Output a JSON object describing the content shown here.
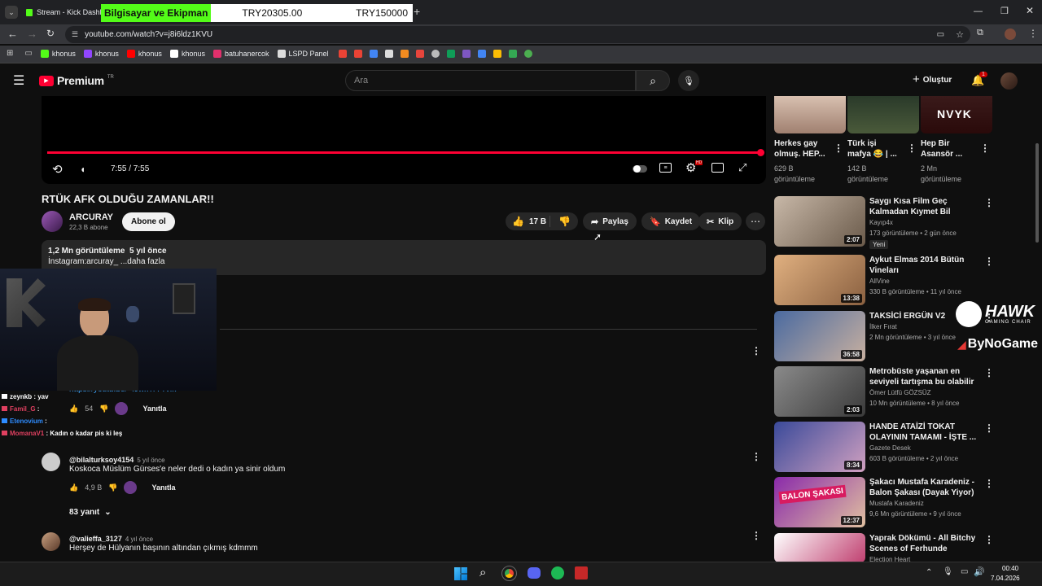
{
  "browser": {
    "tab_title": "Stream - Kick Dashbo",
    "new_tab": "+",
    "url": "youtube.com/watch?v=j8i6ldz1KVU",
    "bookmarks": [
      {
        "label": "khonus",
        "color": "#53fc18"
      },
      {
        "label": "khonus",
        "color": "#9146ff"
      },
      {
        "label": "khonus",
        "color": "#ff0000"
      },
      {
        "label": "khonus",
        "color": "#ffffff"
      },
      {
        "label": "batuhanercok",
        "color": "#e1306c"
      },
      {
        "label": "LSPD Panel",
        "color": "#dddddd"
      }
    ]
  },
  "overlay_banner": {
    "label": "Bilgisayar ve Ekipman",
    "value1": "TRY20305.00",
    "value2": "TRY150000"
  },
  "youtube": {
    "logo": "Premium",
    "region": "TR",
    "search_placeholder": "Ara",
    "create_label": "Oluştur",
    "notif_count": "1"
  },
  "player": {
    "time": "7:55 / 7:55",
    "progress": 1.0,
    "accent": "#ff0033"
  },
  "video": {
    "title": "RTÜK AFK OLDUĞU ZAMANLAR!!",
    "channel": "ARCURAY",
    "subs": "22,3 B abone",
    "subscribe": "Abone ol",
    "likes": "17 B",
    "share": "Paylaş",
    "save": "Kaydet",
    "clip": "Klip",
    "views_line": "1,2 Mn görüntüleme  5 yıl önce",
    "desc": "İnstagram:arcuray_ ...daha fazla"
  },
  "comments": [
    {
      "link": "https://youtu.be/-4JwxTrTYvIk",
      "likes": "54",
      "reply": "Yanıtla"
    },
    {
      "author": "@bilalturksoy4154",
      "time": "5 yıl önce",
      "text": "Koskoca Müslüm Gürses'e neler dedi o kadın ya sinir oldum",
      "likes": "4,9 B",
      "reply": "Yanıtla",
      "replies": "83 yanıt"
    },
    {
      "author": "@valieffa_3127",
      "time": "4 yıl önce",
      "text": "Herşey de Hülyanın başının altından çıkmış kdmmm"
    }
  ],
  "chat": [
    {
      "user": "zeynkb",
      "msg": " : yav",
      "color": "#ffffff"
    },
    {
      "user": "Famil_G",
      "msg": " : ",
      "color": "#e04060"
    },
    {
      "user": "Etenovium",
      "msg": " : ",
      "color": "#2e8cff"
    },
    {
      "user": "MomanaV1",
      "msg": " : Kadın o kadar pis ki leş",
      "color": "#e04060"
    }
  ],
  "top_recs": [
    {
      "title": "Herkes gay olmuş. HEP...",
      "views": "629 B",
      "unit": "görüntüleme"
    },
    {
      "title": "Türk işi mafya 😂 | ...",
      "views": "142 B",
      "unit": "görüntüleme"
    },
    {
      "title": "Hep Bir Asansör ...",
      "views": "2 Mn",
      "unit": "görüntüleme"
    }
  ],
  "nvyk_text": "NVYK",
  "recs": [
    {
      "title": "Saygı Kısa Film Geç Kalmadan Kıymet Bil",
      "channel": "Kayıp4x",
      "meta": "173 görüntüleme • 2 gün önce",
      "badge": "Yeni",
      "duration": "2:07"
    },
    {
      "title": "Aykut Elmas 2014 Bütün Vineları",
      "channel": "AllVine",
      "meta": "330 B görüntüleme • 11 yıl önce",
      "duration": "13:38"
    },
    {
      "title": "TAKSİCİ ERGÜN V2",
      "channel": "İlker Fırat",
      "meta": "2 Mn görüntüleme • 3 yıl önce",
      "duration": "36:58"
    },
    {
      "title": "Metrobüste yaşanan en seviyeli tartışma bu olabilir",
      "channel": "Ömer Lütfü GÖZSÜZ",
      "meta": "10 Mn görüntüleme • 8 yıl önce",
      "duration": "2:03"
    },
    {
      "title": "HANDE ATAİZİ TOKAT OLAYININ TAMAMI - İŞTE ...",
      "channel": "Gazete Desek",
      "meta": "603 B görüntüleme • 2 yıl önce",
      "duration": "8:34"
    },
    {
      "title": "Şakacı Mustafa Karadeniz - Balon Şakası (Dayak Yiyor)",
      "channel": "Mustafa Karadeniz",
      "meta": "9,6 Mn görüntüleme • 9 yıl önce",
      "duration": "12:37"
    },
    {
      "title": "Yaprak Dökümü - All Bitchy Scenes of Ferhunde",
      "channel": "Election Heart"
    }
  ],
  "sponsor": {
    "hawk": "HAWK",
    "hawk_sub": "GAMING CHAIR",
    "bng": "ByNoGame"
  },
  "balon_text": "BALON ŞAKASI",
  "taskbar": {
    "time": "00:40",
    "date": "7.04.2026"
  }
}
